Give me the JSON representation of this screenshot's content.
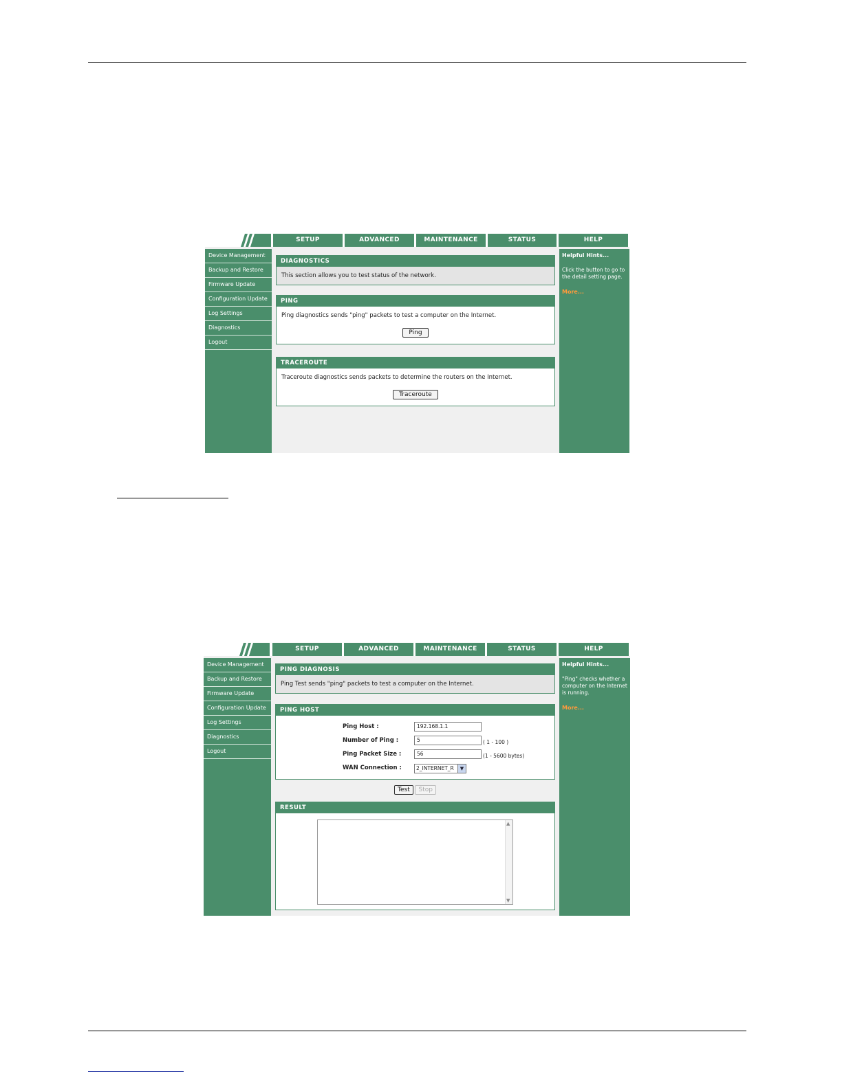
{
  "nav": {
    "tabs": [
      "SETUP",
      "ADVANCED",
      "MAINTENANCE",
      "STATUS",
      "HELP"
    ],
    "sidebar": [
      "Device Management",
      "Backup and Restore",
      "Firmware Update",
      "Configuration Update",
      "Log Settings",
      "Diagnostics",
      "Logout"
    ]
  },
  "shot1": {
    "diagnostics": {
      "title": "DIAGNOSTICS",
      "text": "This section allows you to test status of the network."
    },
    "ping": {
      "title": "PING",
      "text": "Ping diagnostics sends \"ping\" packets to test a computer on the Internet.",
      "button": "Ping"
    },
    "traceroute": {
      "title": "TRACEROUTE",
      "text": "Traceroute diagnostics sends packets to determine the routers on the Internet.",
      "button": "Traceroute"
    },
    "hints": {
      "title": "Helpful Hints...",
      "text": "Click the button to go to the detail setting page.",
      "more": "More..."
    }
  },
  "shot2": {
    "diagnosis": {
      "title": "PING DIAGNOSIS",
      "text": "Ping Test sends \"ping\" packets to test a computer on the Internet."
    },
    "host": {
      "title": "PING HOST",
      "ping_host_label": "Ping Host :",
      "ping_host_value": "192.168.1.1",
      "count_label": "Number of Ping :",
      "count_value": "5",
      "count_hint": "( 1 - 100 )",
      "size_label": "Ping Packet Size :",
      "size_value": "56",
      "size_hint": "(1 - 5600 bytes)",
      "wan_label": "WAN Connection :",
      "wan_value": "2_INTERNET_R"
    },
    "test_button": "Test",
    "stop_button": "Stop",
    "result": {
      "title": "RESULT"
    },
    "hints": {
      "title": "Helpful Hints...",
      "text": "\"Ping\" checks whether a computer on the Internet is running.",
      "more": "More..."
    }
  }
}
